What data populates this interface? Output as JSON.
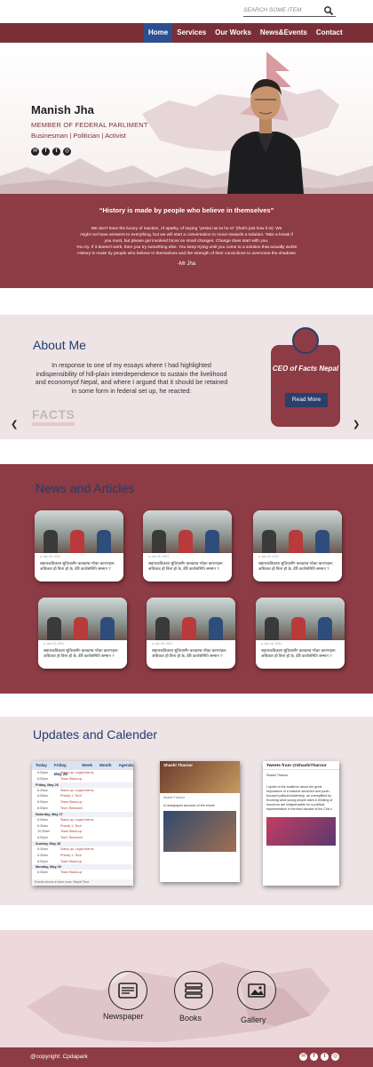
{
  "search": {
    "placeholder": "SEARCH SOME ITEM"
  },
  "nav": {
    "items": [
      "Home",
      "Services",
      "Our Works",
      "News&Events",
      "Contact"
    ],
    "active": "Home"
  },
  "hero": {
    "name": "Manish Jha",
    "role": "MEMBER OF FEDERAL PARLIMENT",
    "tags": "Businesman | Politician | Activist",
    "social": [
      "email-icon",
      "facebook-icon",
      "twitter-icon",
      "instagram-icon"
    ]
  },
  "quote": {
    "headline": "“History is made by people who believe in themselves”",
    "lines": [
      "We don't have the luxury of inaction, of apathy, of saying \"yestai nai ta ho ni\" (that's just how it is). We",
      "might not have answers to everything, but we will start a conversation to move towards a solution. Take a break if",
      "you must, but please get involved    focus on small changes. Change does start with you.",
      "You try. If it doesn't work, then you try something else. You keep trying until you come to a solution that actually works",
      ". History is made by people who believe in themselves and the strength of their convictions to overcome the shadows ."
    ],
    "author": "-Mr Jha"
  },
  "about": {
    "title": "About Me",
    "text": "In response to one of my essays where I had highlighted indispensibility of hill-plain interdependence to sustain the livelihood and economyof Nepal, and where I argued that it should be retained in some form in federal set up, he reacted:",
    "logo_text": "FACTS",
    "card_title": "CEO of Facts Nepal",
    "card_button": "Read More"
  },
  "news": {
    "title": "News and Articles",
    "cards": [
      {
        "date": "● Jan 18, 2021",
        "text": "सहायकविकाश सुविधासँग करखण्ड गरेका कारणहरू: अधिकार हो बिना हो के, डेरि कार्यसमिति सम्मान ?"
      },
      {
        "date": "● Jan 18, 2021",
        "text": "सहायकविकाश सुविधासँग करखण्ड गरेका कारणहरू: अधिकार हो बिना हो के, डेरि कार्यसमिति सम्मान ?"
      },
      {
        "date": "● Jan 18, 2021",
        "text": "सहायकविकाश सुविधासँग करखण्ड गरेका कारणहरू: अधिकार हो बिना हो के, डेरि कार्यसमिति सम्मान ?"
      },
      {
        "date": "● Jan 18, 2021",
        "text": "सहायकविकाश सुविधासँग करखण्ड गरेका कारणहरू: अधिकार हो बिना हो के, डेरि कार्यसमिति सम्मान ?"
      },
      {
        "date": "● Jan 18, 2021",
        "text": "सहायकविकाश सुविधासँग करखण्ड गरेका कारणहरू: अधिकार हो बिना हो के, डेरि कार्यसमिति सम्मान ?"
      },
      {
        "date": "● Jan 18, 2021",
        "text": "सहायकविकाश सुविधासँग करखण्ड गरेका कारणहरू: अधिकार हो बिना हो के, डेरि कार्यसमिति सम्मान ?"
      }
    ]
  },
  "updates": {
    "title": "Updates and Calender",
    "calendar": {
      "header": [
        "Today",
        "Friday, May 26",
        "Week",
        "Month",
        "Agenda"
      ],
      "rows": [
        {
          "t": "6:30am",
          "n": "Stand-up: Legal Interns"
        },
        {
          "t": "8:00pm",
          "n": "Team Stand-up"
        },
        {
          "day": "Friday, May 26"
        },
        {
          "t": "6:30am",
          "n": "Stand-up: Legal Interns"
        },
        {
          "t": "6:30am",
          "n": "Priority 1: Tech"
        },
        {
          "t": "8:00pm",
          "n": "Team Stand-up"
        },
        {
          "t": "8:00pm",
          "n": "Tech: Research"
        },
        {
          "day": "Saturday, May 27"
        },
        {
          "t": "6:30am",
          "n": "Stand-up: Legal Interns"
        },
        {
          "t": "6:30am",
          "n": "Priority 1: Tech"
        },
        {
          "t": "10:30am",
          "n": "Team Stand-up"
        },
        {
          "t": "8:00pm",
          "n": "Tech: Research"
        },
        {
          "day": "Sunday, May 28"
        },
        {
          "t": "6:30am",
          "n": "Stand-up: Legal Interns"
        },
        {
          "t": "6:30am",
          "n": "Priority 1: Tech"
        },
        {
          "t": "8:00pm",
          "n": "Team Stand-up"
        },
        {
          "day": "Monday, May 29"
        },
        {
          "t": "6:30am",
          "n": "Team Stand-up"
        }
      ],
      "footer": "Events shown in time zone: Nepal Time"
    },
    "facebook": {
      "page": "Shashi Tharoor",
      "author": "Shashi Tharoor",
      "post": "A newspaper account of the event:"
    },
    "twitter": {
      "header": "Tweets from @ShashiTharoor",
      "author": "Shashi Tharoor",
      "text": "I spoke to the audience about the great importance of a fulsome devolved and youth-focused political leadership, as exemplified by. Knowing what young people want & thinking of tomorrow are indispensable for a political representative in the third decade of the 21st c."
    }
  },
  "footer": {
    "items": [
      {
        "label": "Newspaper",
        "icon": "newspaper-icon"
      },
      {
        "label": "Books",
        "icon": "books-icon"
      },
      {
        "label": "Gallery",
        "icon": "gallery-icon"
      }
    ],
    "copyright": "@copyright: Cpdapark"
  },
  "colors": {
    "maroon": "#8d3b44",
    "nav_dark": "#7a2f36",
    "active_blue": "#2b4f8f",
    "heading_blue": "#1f3e6b",
    "pink_bg": "#eee3e5"
  }
}
